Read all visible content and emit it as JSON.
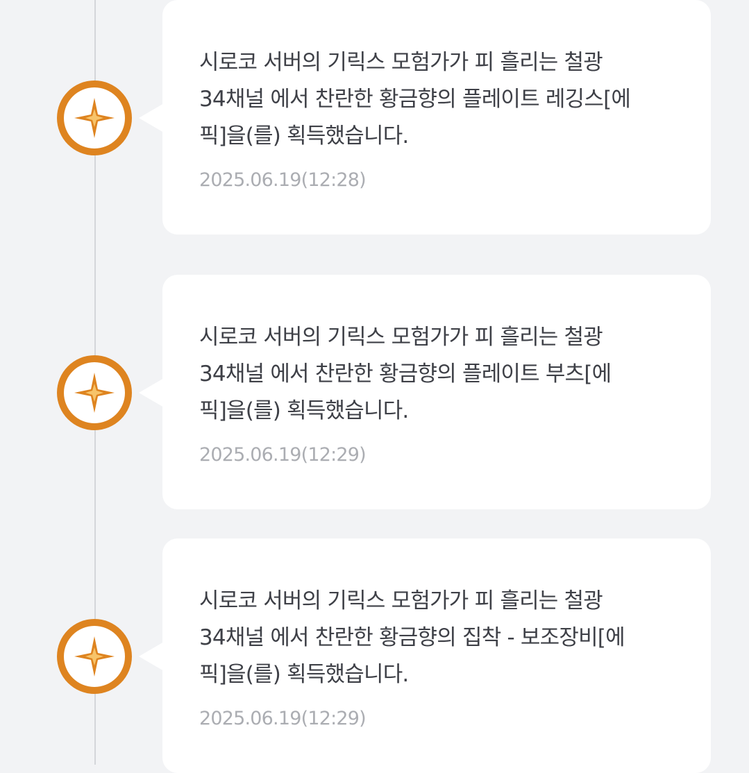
{
  "feed": {
    "items": [
      {
        "lines": [
          "시로코 서버의 기릭스 모험가가 피 흘리는 철광",
          "34채널 에서 찬란한 황금향의 플레이트 부츠[에",
          "픽]을(를) 획득했습니다."
        ],
        "timestamp": "2025.06.19(12:29)"
      },
      {
        "lines": [
          "시로코 서버의 기릭스 모험가가 피 흘리는 철광",
          "34채널 에서 찬란한 황금향의 집착 - 보조장비[에",
          "픽]을(를) 획득했습니다."
        ],
        "timestamp": "2025.06.19(12:29)"
      },
      {
        "lines": [
          "시로코 서버의 기릭스 모험가가 피 흘리는 철광",
          "34채널 에서 찬란한 황금향의 플레이트 레깅스[에",
          "픽]을(를) 획득했습니다."
        ],
        "timestamp": "2025.06.19(12:28)"
      }
    ]
  },
  "icons": {
    "marker": "four-point-star-icon"
  },
  "colors": {
    "accent": "#de8420",
    "background": "#f2f3f5",
    "card": "#ffffff",
    "text": "#3e4047",
    "timestamp": "#abadb2",
    "timeline": "#d4d6da"
  }
}
